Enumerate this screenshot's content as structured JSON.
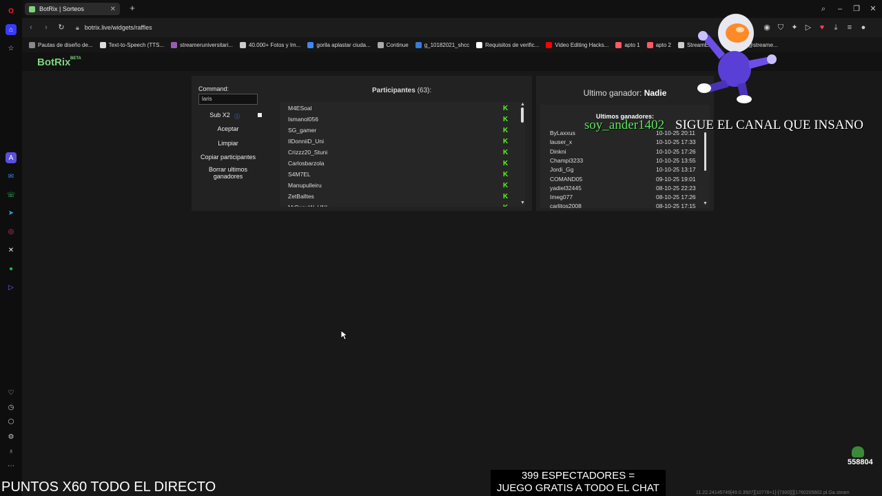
{
  "browser": {
    "tab_title": "BotRix | Sorteos",
    "url": "botrix.live/widgets/raffles",
    "bookmarks": [
      {
        "label": "Pautas de diseño de...",
        "color": "#8a8a8a"
      },
      {
        "label": "Text-to-Speech (TTS...",
        "color": "#dddddd"
      },
      {
        "label": "streameruniversitari...",
        "color": "#9b59b6"
      },
      {
        "label": "40.000+ Fotos y Im...",
        "color": "#cccccc"
      },
      {
        "label": "gorila aplastar ciuda...",
        "color": "#4285f4"
      },
      {
        "label": "Continue",
        "color": "#aaaaaa"
      },
      {
        "label": "g_10182021_shcc",
        "color": "#3a7bd5"
      },
      {
        "label": "Requisitos de verific...",
        "color": "#ffffff"
      },
      {
        "label": "Video Editing Hacks...",
        "color": "#ff0000"
      },
      {
        "label": "apto 1",
        "color": "#ff5a5f"
      },
      {
        "label": "apto 2",
        "color": "#ff5a5f"
      },
      {
        "label": "StreamEle...",
        "color": "#cccccc"
      },
      {
        "label": "/Aris (@streame...",
        "color": "#cccccc"
      }
    ]
  },
  "app": {
    "logo": "BotRix",
    "logo_badge": "BETA"
  },
  "raffle": {
    "command_label": "Command:",
    "command_value": "laris",
    "sub_label": "Sub X2",
    "accept_label": "Aceptar",
    "clear_label": "Limpiar",
    "copy_label": "Copiar participantes",
    "delete_label": "Borrar ultimos ganadores",
    "participants_title": "Participantes",
    "participants_count": "(63):",
    "participants": [
      "M4ESoal",
      "Ismanol056",
      "SG_gamer",
      "IlDonniiD_Uni",
      "Crizzz20_Stuni",
      "Carlosbarzola",
      "S4M7EL",
      "Manupulleiru",
      "ZetBalltes",
      "MrPanuW_UNI"
    ],
    "platform_icon": "K"
  },
  "winners": {
    "last_label": "Ultimo ganador:",
    "last_value": "Nadie",
    "list_title": "Ultimos ganadores:",
    "rows": [
      {
        "name": "ByLaxxus",
        "date": "10-10-25 20:11"
      },
      {
        "name": "lauser_x",
        "date": "10-10-25 17:33"
      },
      {
        "name": "Dinkni",
        "date": "10-10-25 17:26"
      },
      {
        "name": "Champi3233",
        "date": "10-10-25 13:55"
      },
      {
        "name": "Jordi_Gg",
        "date": "10-10-25 13:17"
      },
      {
        "name": "COMAND05",
        "date": "09-10-25 19:01"
      },
      {
        "name": "yadiel32445",
        "date": "08-10-25 22:23"
      },
      {
        "name": "Imeg077",
        "date": "08-10-25 17:26"
      },
      {
        "name": "carlitos2008",
        "date": "08-10-25 17:15"
      }
    ]
  },
  "overlay": {
    "username": "soy_ander1402",
    "follow_text": "SIGUE EL CANAL QUE INSANO",
    "points_text": "PUNTOS X60 TODO EL DIRECTO",
    "spectators_line1": "399 ESPECTADORES =",
    "spectators_line2": "JUEGO GRATIS A TODO EL CHAT",
    "corner_count": "558804",
    "tiny_text": "11.22.24145749[49.0.3507][10778+1]-[7300][][1760205602.pl.Ga.steam"
  }
}
